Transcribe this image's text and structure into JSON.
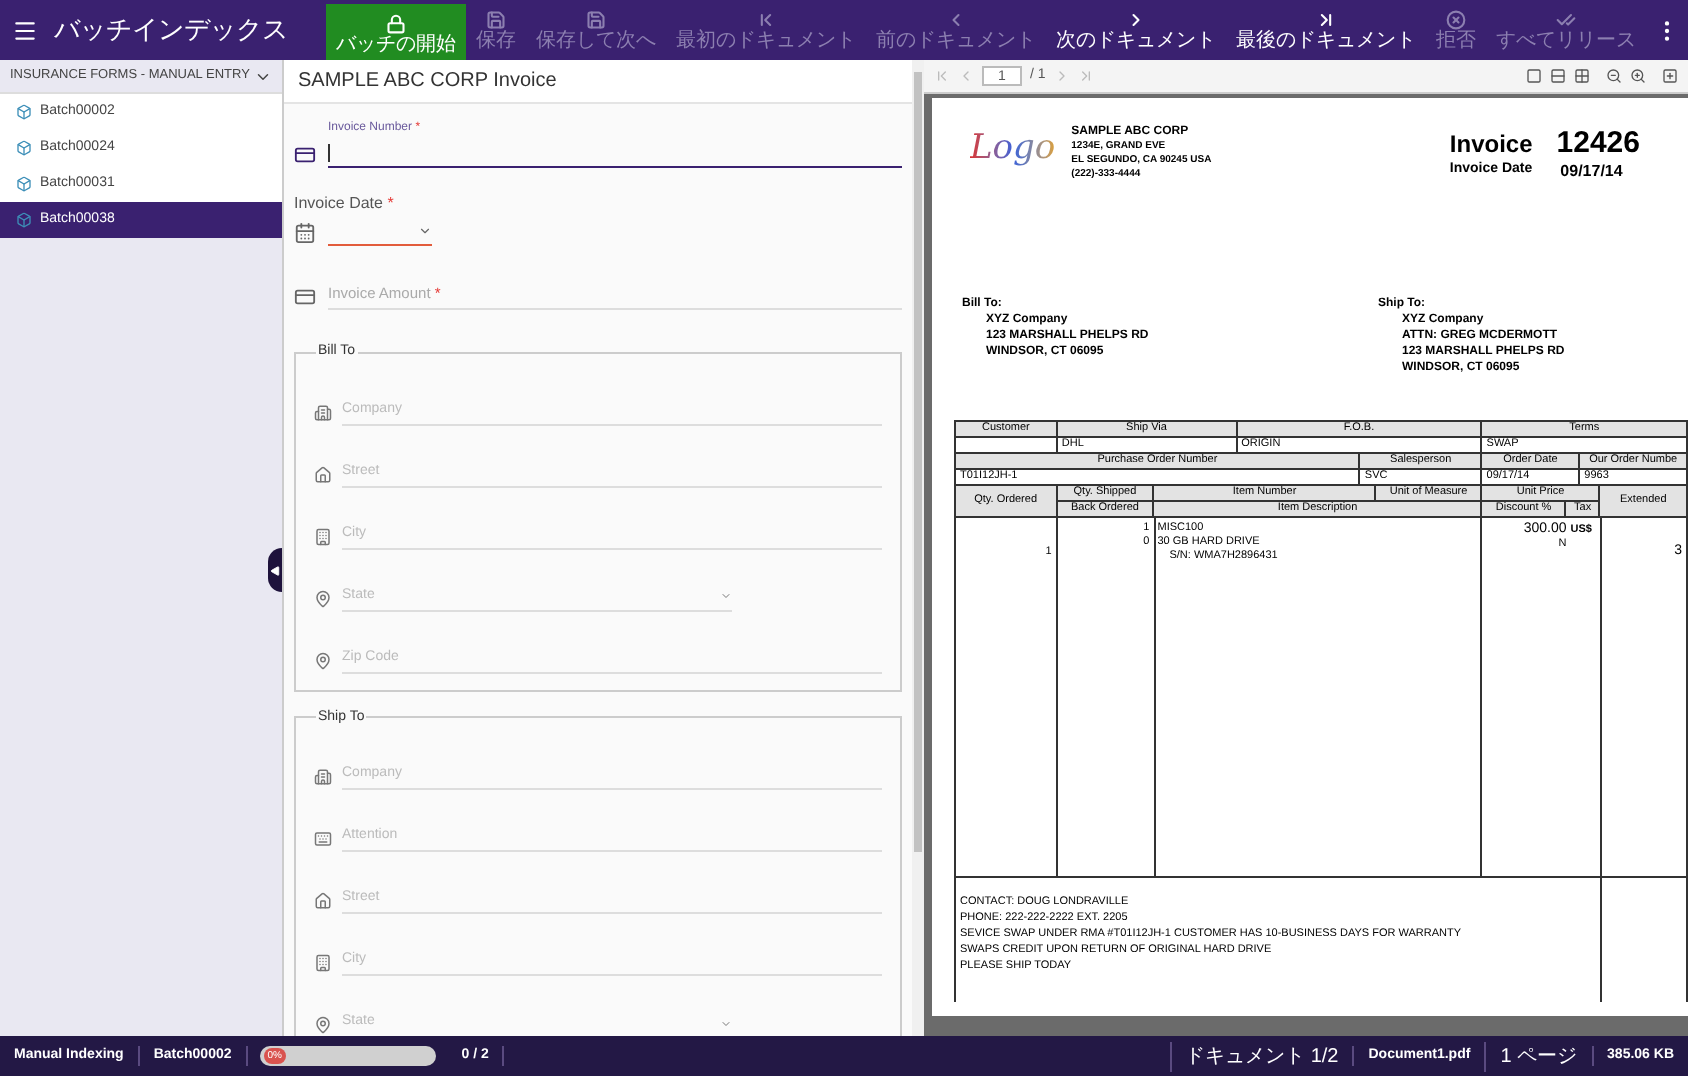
{
  "app": {
    "title": "バッチインデックス"
  },
  "toolbar": [
    {
      "kind": "start",
      "label": "バッチの開始",
      "disabled": false,
      "primary": true
    },
    {
      "kind": "save",
      "label": "保存",
      "disabled": true,
      "primary": false
    },
    {
      "kind": "save-next",
      "label": "保存して次へ",
      "disabled": true,
      "primary": false
    },
    {
      "kind": "first",
      "label": "最初のドキュメント",
      "disabled": true,
      "primary": false
    },
    {
      "kind": "prev",
      "label": "前のドキュメント",
      "disabled": true,
      "primary": false
    },
    {
      "kind": "next",
      "label": "次のドキュメント",
      "disabled": false,
      "primary": false
    },
    {
      "kind": "last",
      "label": "最後のドキュメント",
      "disabled": false,
      "primary": false
    },
    {
      "kind": "reject",
      "label": "拒否",
      "disabled": true,
      "primary": false
    },
    {
      "kind": "release",
      "label": "すべてリリース",
      "disabled": true,
      "primary": false
    }
  ],
  "sidebar": {
    "title": "INSURANCE FORMS - MANUAL ENTRY",
    "items": [
      {
        "label": "Batch00002",
        "selected": false
      },
      {
        "label": "Batch00024",
        "selected": false
      },
      {
        "label": "Batch00031",
        "selected": false
      },
      {
        "label": "Batch00038",
        "selected": true
      }
    ]
  },
  "form": {
    "title": "SAMPLE ABC CORP Invoice",
    "fields": [
      {
        "kind": "card",
        "label": "Invoice Number",
        "required": "*",
        "focused": true,
        "invalid": false
      },
      {
        "kind": "date",
        "label": "Invoice Date",
        "required": "*",
        "focused": false,
        "invalid": true
      },
      {
        "kind": "card",
        "label": "Invoice Amount",
        "required": "*",
        "focused": false,
        "invalid": false
      }
    ],
    "groups": [
      {
        "title": "Bill To",
        "fields": [
          {
            "kind": "company",
            "placeholder": "Company"
          },
          {
            "kind": "street",
            "placeholder": "Street"
          },
          {
            "kind": "city",
            "placeholder": "City"
          },
          {
            "kind": "state",
            "placeholder": "State"
          },
          {
            "kind": "zip",
            "placeholder": "Zip Code"
          }
        ]
      },
      {
        "title": "Ship To",
        "fields": [
          {
            "kind": "company",
            "placeholder": "Company"
          },
          {
            "kind": "attention",
            "placeholder": "Attention"
          },
          {
            "kind": "street",
            "placeholder": "Street"
          },
          {
            "kind": "city",
            "placeholder": "City"
          },
          {
            "kind": "state",
            "placeholder": "State"
          }
        ]
      }
    ]
  },
  "viewer": {
    "pager": {
      "page": "1",
      "total": "/ 1",
      "buttons": [
        {
          "kind": "first",
          "disabled": true
        },
        {
          "kind": "prev",
          "disabled": true
        },
        {
          "kind": "next",
          "disabled": true
        },
        {
          "kind": "last",
          "disabled": true
        }
      ]
    },
    "document": {
      "logo": "Logo",
      "company": [
        "SAMPLE ABC CORP",
        "1234E, GRAND EVE",
        "EL SEGUNDO, CA 90245 USA",
        "(222)-333-4444"
      ],
      "title": "Invoice",
      "number": "12426",
      "date_label": "Invoice Date",
      "date": "09/17/14",
      "bill_to": {
        "label": "Bill To:",
        "lines": [
          "XYZ Company",
          "123 MARSHALL PHELPS RD",
          "WINDSOR, CT 06095"
        ]
      },
      "ship_to": {
        "label": "Ship To:",
        "lines": [
          "XYZ Company",
          "ATTN: GREG MCDERMOTT",
          "123 MARSHALL PHELPS RD",
          "WINDSOR, CT 06095"
        ]
      },
      "table_rows": [
        {
          "kind": "head",
          "cells": [
            "Customer",
            "Ship Via",
            "F.O.B.",
            "Terms"
          ]
        },
        {
          "kind": "body",
          "cells": [
            "",
            "DHL",
            "ORIGIN",
            "SWAP"
          ]
        },
        {
          "kind": "head",
          "cells": [
            "Purchase Order Number",
            "Salesperson",
            "Order Date",
            "Our Order Numbe"
          ]
        },
        {
          "kind": "body",
          "cells": [
            "T01I12JH-1",
            "SVC",
            "09/17/14",
            "9963"
          ]
        }
      ],
      "item_head": {
        "qty_ordered": "Qty. Ordered",
        "qty_shipped": "Qty. Shipped",
        "back_ordered": "Back Ordered",
        "item_number": "Item Number",
        "unit": "Unit of Measure",
        "item_description": "Item Description",
        "unit_price": "Unit Price",
        "discount": "Discount %",
        "tax": "Tax",
        "extended": "Extended"
      },
      "item": {
        "qty_ordered": "1",
        "qty_shipped": "1",
        "back_ordered": "0",
        "lines": [
          "MISC100",
          "30 GB HARD DRIVE",
          "S/N: WMA7H2896431"
        ],
        "price": "300.00",
        "tax": "N",
        "currency": "US$",
        "extended": "3"
      },
      "notes": [
        "CONTACT: DOUG LONDRAVILLE",
        "PHONE:  222-222-2222 EXT. 2205",
        "SEVICE SWAP UNDER RMA #T01I12JH-1 CUSTOMER HAS 10-BUSINESS DAYS FOR WARRANTY",
        "SWAPS CREDIT UPON RETURN OF ORIGINAL HARD DRIVE",
        "PLEASE SHIP TODAY"
      ]
    }
  },
  "status_bar": {
    "mode": "Manual Indexing",
    "batch": "Batch00002",
    "progress": {
      "level": 0,
      "label": "0%"
    },
    "count": "0 / 2",
    "document": "ドキュメント 1/2",
    "file": "Document1.pdf",
    "pages": "1 ページ",
    "size": "385.06 KB"
  }
}
